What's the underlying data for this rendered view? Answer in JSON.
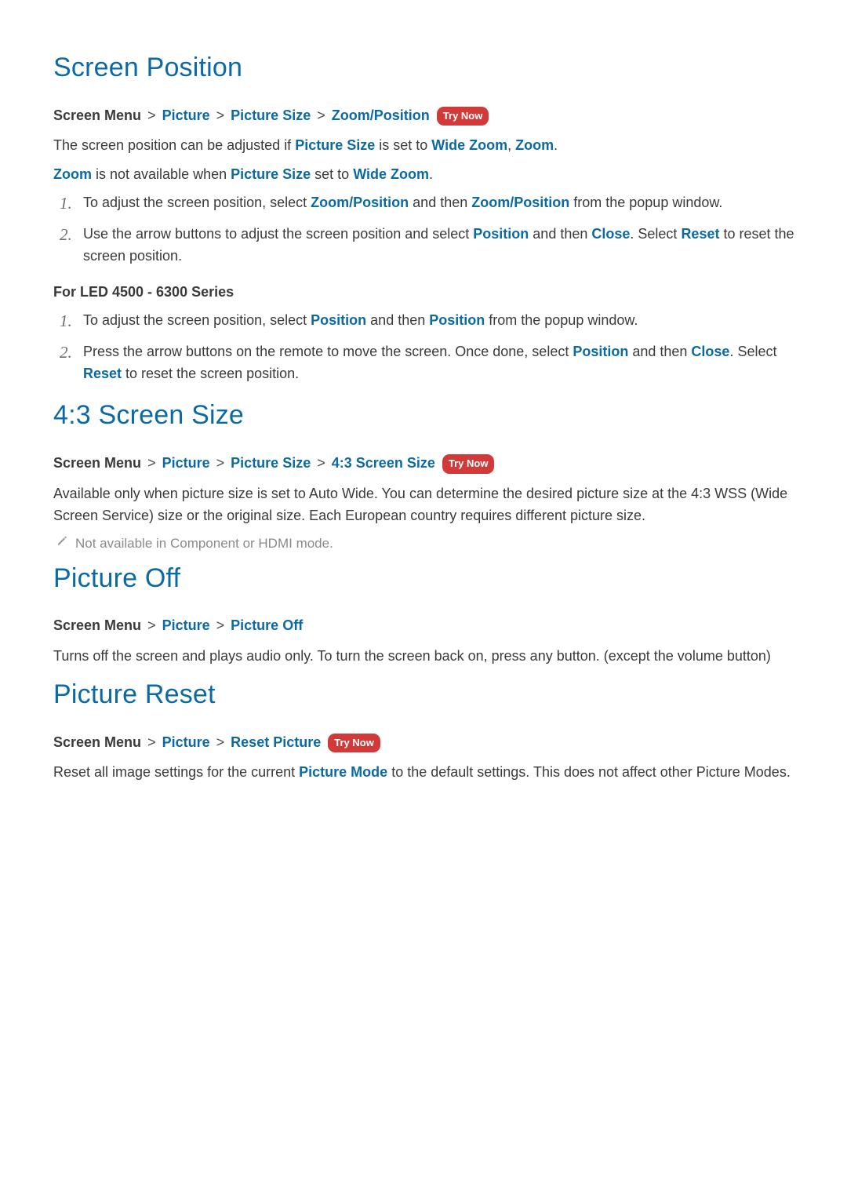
{
  "common": {
    "try_now": "Try Now",
    "breadcrumb_root": "Screen Menu",
    "breadcrumb_picture": "Picture",
    "breadcrumb_picture_size": "Picture Size"
  },
  "screen_position": {
    "title": "Screen Position",
    "crumb_last": "Zoom/Position",
    "p1_a": "The screen position can be adjusted if ",
    "p1_hl1": "Picture Size",
    "p1_b": " is set to ",
    "p1_hl2": "Wide Zoom",
    "p1_c": ", ",
    "p1_hl3": "Zoom",
    "p1_d": ".",
    "p2_hl1": "Zoom",
    "p2_a": " is not available when ",
    "p2_hl2": "Picture Size",
    "p2_b": " set to ",
    "p2_hl3": "Wide Zoom",
    "p2_c": ".",
    "list1": {
      "n1": "1.",
      "li1_a": "To adjust the screen position, select ",
      "li1_hl1": "Zoom/Position",
      "li1_b": " and then ",
      "li1_hl2": "Zoom/Position",
      "li1_c": " from the popup window.",
      "n2": "2.",
      "li2_a": "Use the arrow buttons to adjust the screen position and select ",
      "li2_hl1": "Position",
      "li2_b": " and then ",
      "li2_hl2": "Close",
      "li2_c": ". Select ",
      "li2_hl3": "Reset",
      "li2_d": " to reset the screen position."
    },
    "subhead": "For LED 4500 - 6300 Series",
    "list2": {
      "n1": "1.",
      "li1_a": "To adjust the screen position, select ",
      "li1_hl1": "Position",
      "li1_b": " and then ",
      "li1_hl2": "Position",
      "li1_c": " from the popup window.",
      "n2": "2.",
      "li2_a": "Press the arrow buttons on the remote to move the screen. Once done, select ",
      "li2_hl1": "Position",
      "li2_b": " and then ",
      "li2_hl2": "Close",
      "li2_c": ". Select ",
      "li2_hl3": "Reset",
      "li2_d": " to reset the screen position."
    }
  },
  "ratio_43": {
    "title": "4:3 Screen Size",
    "crumb_last": "4:3 Screen Size",
    "p1": "Available only when picture size is set to Auto Wide. You can determine the desired picture size at the 4:3 WSS (Wide Screen Service) size or the original size. Each European country requires different picture size.",
    "note": "Not available in Component or HDMI mode."
  },
  "picture_off": {
    "title": "Picture Off",
    "crumb_last": "Picture Off",
    "p1": "Turns off the screen and plays audio only. To turn the screen back on, press any button. (except the volume button)"
  },
  "picture_reset": {
    "title": "Picture Reset",
    "crumb_last": "Reset Picture",
    "p1_a": "Reset all image settings for the current ",
    "p1_hl1": "Picture Mode",
    "p1_b": " to the default settings. This does not affect other Picture Modes."
  }
}
